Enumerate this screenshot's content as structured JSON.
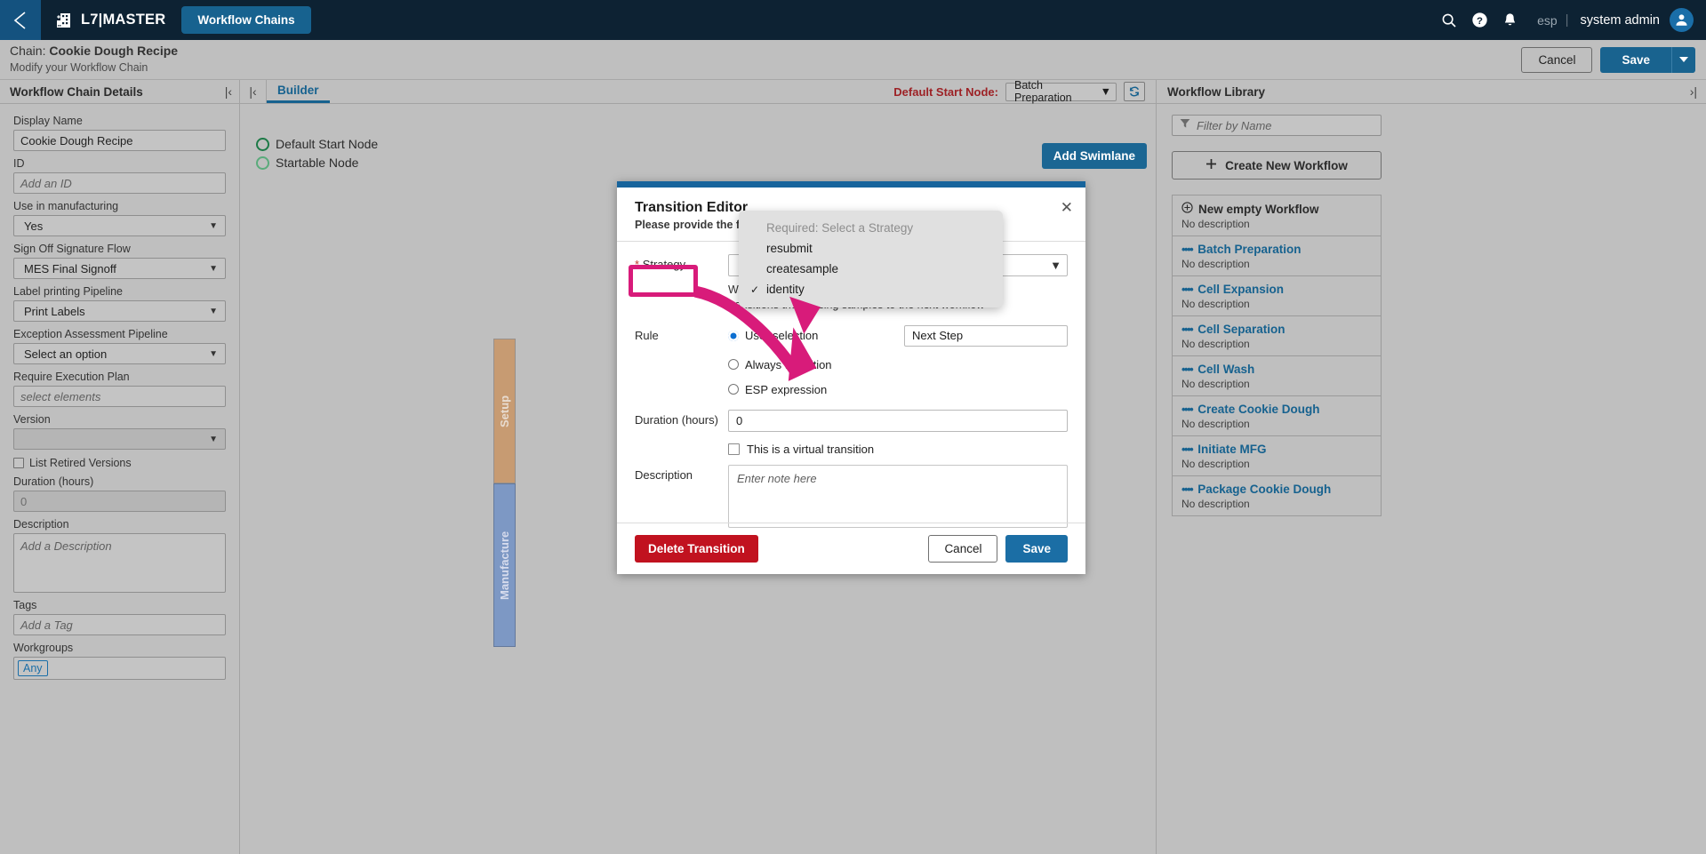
{
  "topnav": {
    "back_icon": "chevron-left-icon",
    "brand_icon": "building-add-icon",
    "brand": "L7|MASTER",
    "module_tab": "Workflow Chains",
    "search_icon": "search-icon",
    "help_icon": "help-circle-icon",
    "bell_icon": "bell-icon",
    "locale": "esp",
    "divider": "|",
    "user": "system admin",
    "avatar_icon": "user-avatar-icon"
  },
  "page_header": {
    "title_prefix": "Chain: ",
    "title": "Cookie Dough Recipe",
    "subtitle": "Modify your Workflow Chain",
    "cancel": "Cancel",
    "save": "Save",
    "save_caret_icon": "chevron-down-icon"
  },
  "left_panel": {
    "title": "Workflow Chain Details",
    "collapse_icon": "collapse-left-icon",
    "fields": {
      "display_name_label": "Display Name",
      "display_name_value": "Cookie Dough Recipe",
      "id_label": "ID",
      "id_placeholder": "Add an ID",
      "use_in_mfg_label": "Use in manufacturing",
      "use_in_mfg_value": "Yes",
      "signoff_label": "Sign Off Signature Flow",
      "signoff_value": "MES Final Signoff",
      "label_pipeline_label": "Label printing Pipeline",
      "label_pipeline_value": "Print Labels",
      "exception_label": "Exception Assessment Pipeline",
      "exception_value": "Select an option",
      "exec_plan_label": "Require Execution Plan",
      "exec_plan_placeholder": "select elements",
      "version_label": "Version",
      "version_value": "",
      "list_retired_label": "List Retired Versions",
      "duration_label": "Duration (hours)",
      "duration_value": "0",
      "description_label": "Description",
      "description_placeholder": "Add a Description",
      "tags_label": "Tags",
      "tags_placeholder": "Add a Tag",
      "workgroups_label": "Workgroups",
      "workgroups_chip": "Any"
    }
  },
  "builder": {
    "collapse_icon": "collapse-left-icon",
    "tab": "Builder",
    "start_node_label": "Default Start Node:",
    "start_node_value": "Batch Preparation",
    "refresh_icon": "refresh-icon",
    "add_swimlane": "Add Swimlane",
    "nodes": [
      {
        "label": "Default Start Node",
        "dot": "circle-outline-icon"
      },
      {
        "label": "Startable Node",
        "dot": "circle-outline-icon"
      }
    ],
    "swimlanes": [
      {
        "label": "Setup",
        "color": "#c79b72"
      },
      {
        "label": "Manufacture",
        "color": "#7d98c4"
      }
    ]
  },
  "right_panel": {
    "title": "Workflow Library",
    "collapse_icon": "collapse-right-icon",
    "filter_icon": "filter-icon",
    "filter_placeholder": "Filter by Name",
    "create_button": "Create New Workflow",
    "create_icon": "plus-icon",
    "items": [
      {
        "icon": "plus-circle-icon",
        "name": "New empty Workflow",
        "desc": "No description"
      },
      {
        "icon": "dots-icon",
        "name": "Batch Preparation",
        "desc": "No description"
      },
      {
        "icon": "dots-icon",
        "name": "Cell Expansion",
        "desc": "No description"
      },
      {
        "icon": "dots-icon",
        "name": "Cell Separation",
        "desc": "No description"
      },
      {
        "icon": "dots-icon",
        "name": "Cell Wash",
        "desc": "No description"
      },
      {
        "icon": "dots-icon",
        "name": "Create Cookie Dough",
        "desc": "No description"
      },
      {
        "icon": "dots-icon",
        "name": "Initiate MFG",
        "desc": "No description"
      },
      {
        "icon": "dots-icon",
        "name": "Package Cookie Dough",
        "desc": "No description"
      }
    ]
  },
  "modal": {
    "title": "Transition Editor",
    "subtitle": "Please provide the following information",
    "close_icon": "close-icon",
    "strategy_label_req": "*",
    "strategy_label": "Strategy",
    "strategy_help": "Workflow chain sample transition strategy that directly transitions the passing samples to the next workflow",
    "rule_label": "Rule",
    "rule_options": [
      {
        "label": "User selection",
        "selected": true
      },
      {
        "label": "Always transition",
        "selected": false
      },
      {
        "label": "ESP expression",
        "selected": false
      }
    ],
    "rule_value": "Next Step",
    "duration_label": "Duration (hours)",
    "duration_value": "0",
    "virtual_label": "This is a virtual transition",
    "description_label": "Description",
    "description_placeholder": "Enter note here",
    "delete_button": "Delete Transition",
    "cancel_button": "Cancel",
    "save_button": "Save"
  },
  "strategy_dropdown": {
    "items": [
      {
        "label": "Required: Select a Strategy",
        "checked": false,
        "placeholder": true
      },
      {
        "label": "resubmit",
        "checked": false,
        "placeholder": false
      },
      {
        "label": "createsample",
        "checked": false,
        "placeholder": false
      },
      {
        "label": "identity",
        "checked": true,
        "placeholder": false
      }
    ],
    "check_glyph": "✓"
  },
  "annotation": {
    "color": "#d81b7a",
    "target": "Strategy"
  }
}
